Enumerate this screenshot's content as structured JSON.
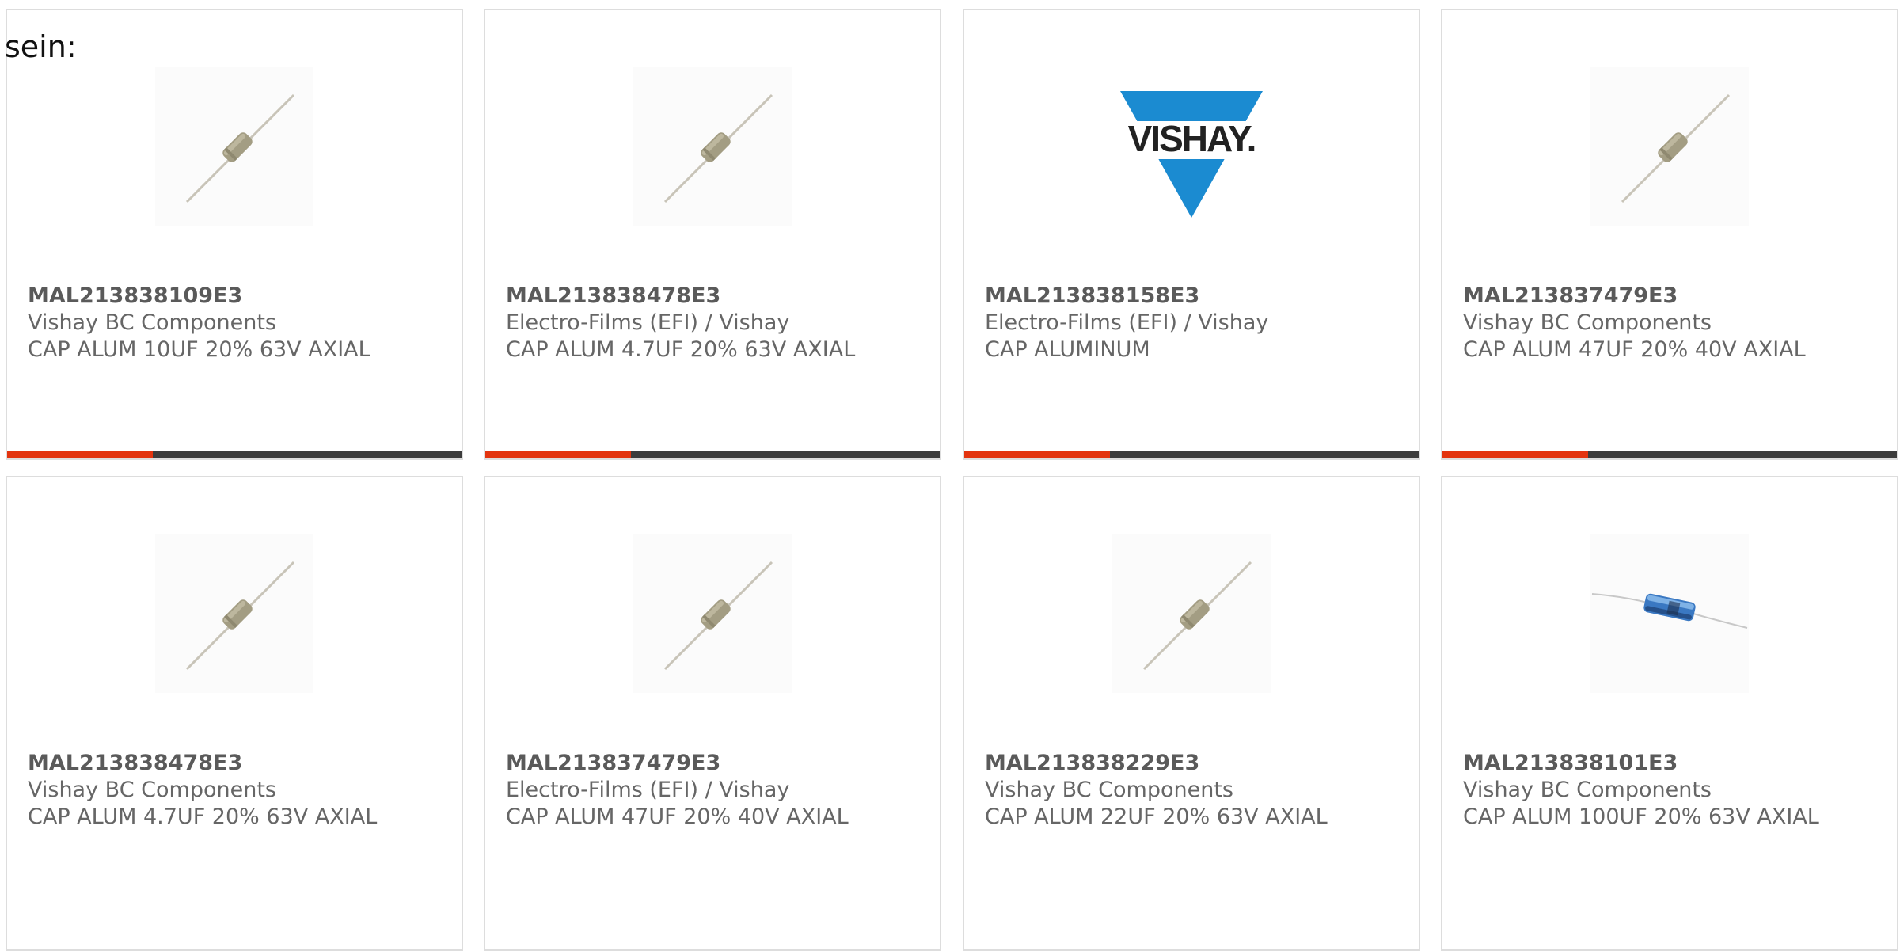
{
  "intro_text": "sein:",
  "colors": {
    "accent": "#e3340f",
    "bar_track": "#3c3c3c",
    "vishay_blue": "#1b8bd1"
  },
  "products": [
    {
      "part_number": "MAL213838109E3",
      "manufacturer": "Vishay BC Components",
      "description": "CAP ALUM 10UF 20% 63V AXIAL",
      "image": "axial-capacitor-beige-icon"
    },
    {
      "part_number": "MAL213838478E3",
      "manufacturer": "Electro-Films (EFI) / Vishay",
      "description": "CAP ALUM 4.7UF 20% 63V AXIAL",
      "image": "axial-capacitor-beige-icon"
    },
    {
      "part_number": "MAL213838158E3",
      "manufacturer": "Electro-Films (EFI) / Vishay",
      "description": "CAP ALUMINUM",
      "image": "vishay-logo",
      "logo_text": "VISHAY."
    },
    {
      "part_number": "MAL213837479E3",
      "manufacturer": "Vishay BC Components",
      "description": "CAP ALUM 47UF 20% 40V AXIAL",
      "image": "axial-capacitor-beige-icon"
    },
    {
      "part_number": "MAL213838478E3",
      "manufacturer": "Vishay BC Components",
      "description": "CAP ALUM 4.7UF 20% 63V AXIAL",
      "image": "axial-capacitor-beige-icon"
    },
    {
      "part_number": "MAL213837479E3",
      "manufacturer": "Electro-Films (EFI) / Vishay",
      "description": "CAP ALUM 47UF 20% 40V AXIAL",
      "image": "axial-capacitor-beige-icon"
    },
    {
      "part_number": "MAL213838229E3",
      "manufacturer": "Vishay BC Components",
      "description": "CAP ALUM 22UF 20% 63V AXIAL",
      "image": "axial-capacitor-beige-icon"
    },
    {
      "part_number": "MAL213838101E3",
      "manufacturer": "Vishay BC Components",
      "description": "CAP ALUM 100UF 20% 63V AXIAL",
      "image": "axial-capacitor-blue-icon"
    }
  ]
}
